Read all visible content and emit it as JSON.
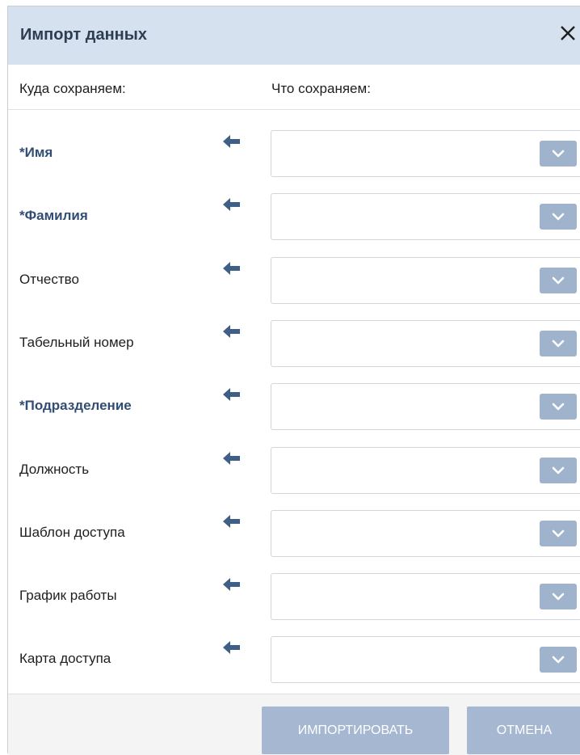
{
  "dialog": {
    "title": "Импорт данных",
    "close_icon": "close-icon",
    "columns": {
      "target": "Куда сохраняем:",
      "source": "Что сохраняем:"
    },
    "rows": [
      {
        "label": "*Имя",
        "required": true,
        "value": ""
      },
      {
        "label": "*Фамилия",
        "required": true,
        "value": ""
      },
      {
        "label": "Отчество",
        "required": false,
        "value": ""
      },
      {
        "label": "Табельный номер",
        "required": false,
        "value": ""
      },
      {
        "label": "*Подразделение",
        "required": true,
        "value": ""
      },
      {
        "label": "Должность",
        "required": false,
        "value": ""
      },
      {
        "label": "Шаблон доступа",
        "required": false,
        "value": ""
      },
      {
        "label": "График работы",
        "required": false,
        "value": ""
      },
      {
        "label": "Карта доступа",
        "required": false,
        "value": ""
      }
    ],
    "buttons": {
      "import": "ИМПОРТИРОВАТЬ",
      "cancel": "ОТМЕНА"
    },
    "colors": {
      "header_bg": "#d5e1ef",
      "required_label": "#304d74",
      "arrow": "#3f5f86",
      "dropdown_button": "#9fb3cd",
      "action_button": "#a5b7d1"
    },
    "icons": {
      "row_arrow": "arrow-left-icon",
      "dropdown": "chevron-down-icon"
    }
  }
}
